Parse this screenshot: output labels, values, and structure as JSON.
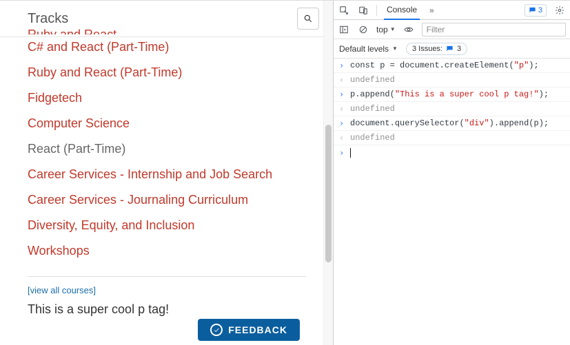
{
  "page": {
    "title": "Tracks",
    "search_placeholder": "Search",
    "tracks": [
      {
        "label": "Ruby and React",
        "link": true,
        "cut": true
      },
      {
        "label": "C# and React (Part-Time)",
        "link": true
      },
      {
        "label": "Ruby and React (Part-Time)",
        "link": true
      },
      {
        "label": "Fidgetech",
        "link": true
      },
      {
        "label": "Computer Science",
        "link": true
      },
      {
        "label": "React (Part-Time)",
        "link": false
      },
      {
        "label": "Career Services - Internship and Job Search",
        "link": true
      },
      {
        "label": "Career Services - Journaling Curriculum",
        "link": true
      },
      {
        "label": "Diversity, Equity, and Inclusion",
        "link": true
      },
      {
        "label": "Workshops",
        "link": true
      }
    ],
    "view_all": "[view all courses]",
    "appended_text": "This is a super cool p tag!",
    "feedback_label": "FEEDBACK"
  },
  "devtools": {
    "tab_active": "Console",
    "overflow": "»",
    "msg_count": "3",
    "context": "top",
    "filter_placeholder": "Filter",
    "levels_label": "Default levels",
    "issues_label_prefix": "3 Issues:",
    "issues_badge": "3",
    "console": {
      "rows": [
        {
          "type": "in",
          "parts": [
            {
              "t": "kw",
              "v": "const"
            },
            {
              "t": "p",
              "v": " p "
            },
            {
              "t": "op",
              "v": "="
            },
            {
              "t": "p",
              "v": " document"
            },
            {
              "t": "op",
              "v": "."
            },
            {
              "t": "p",
              "v": "createElement"
            },
            {
              "t": "op",
              "v": "("
            },
            {
              "t": "str",
              "v": "\"p\""
            },
            {
              "t": "op",
              "v": ");"
            }
          ]
        },
        {
          "type": "out",
          "text": "undefined"
        },
        {
          "type": "in",
          "parts": [
            {
              "t": "p",
              "v": "p"
            },
            {
              "t": "op",
              "v": "."
            },
            {
              "t": "p",
              "v": "append"
            },
            {
              "t": "op",
              "v": "("
            },
            {
              "t": "str",
              "v": "\"This is a super cool p tag!\""
            },
            {
              "t": "op",
              "v": ");"
            }
          ]
        },
        {
          "type": "out",
          "text": "undefined"
        },
        {
          "type": "in",
          "parts": [
            {
              "t": "p",
              "v": "document"
            },
            {
              "t": "op",
              "v": "."
            },
            {
              "t": "p",
              "v": "querySelector"
            },
            {
              "t": "op",
              "v": "("
            },
            {
              "t": "str",
              "v": "\"div\""
            },
            {
              "t": "op",
              "v": ")"
            },
            {
              "t": "op",
              "v": "."
            },
            {
              "t": "p",
              "v": "append"
            },
            {
              "t": "op",
              "v": "("
            },
            {
              "t": "p",
              "v": "p"
            },
            {
              "t": "op",
              "v": ");"
            }
          ]
        },
        {
          "type": "out",
          "text": "undefined"
        }
      ]
    }
  }
}
